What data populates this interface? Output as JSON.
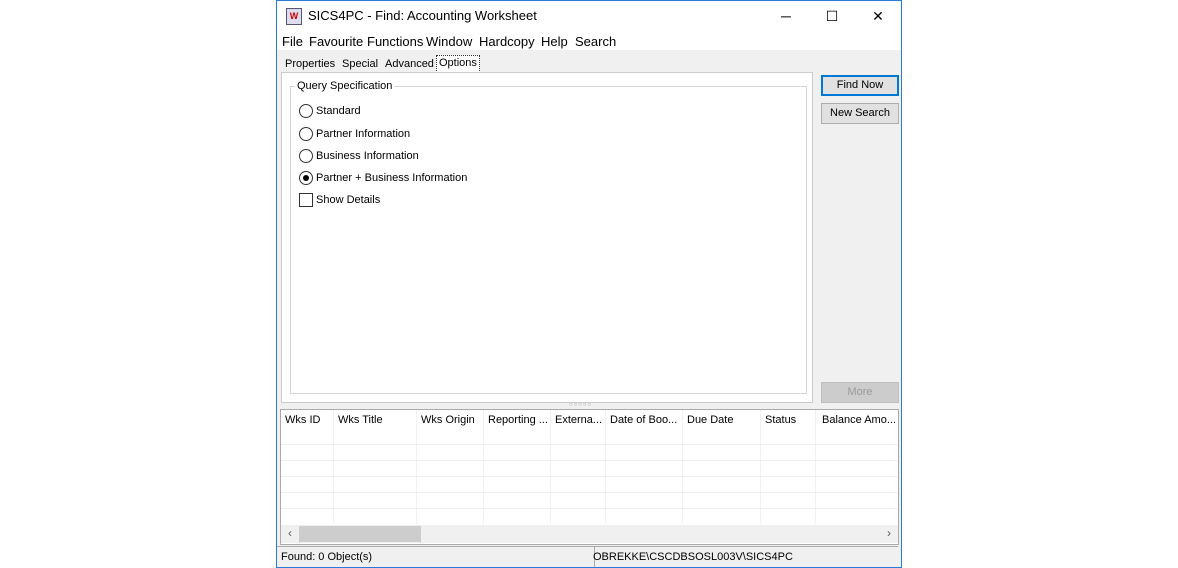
{
  "window": {
    "title": "SICS4PC - Find: Accounting Worksheet",
    "app_icon": "worksheet-icon",
    "controls": {
      "minimize": "─",
      "maximize": "☐",
      "close": "✕"
    }
  },
  "menu": [
    "File",
    "Favourite",
    "Functions",
    "Window",
    "Hardcopy",
    "Help",
    "Search"
  ],
  "tabs": [
    {
      "label": "Properties"
    },
    {
      "label": "Special"
    },
    {
      "label": "Advanced"
    },
    {
      "label": "Options",
      "active": true
    }
  ],
  "query": {
    "group_label": "Query Specification",
    "options": [
      {
        "label": "Standard",
        "selected": false
      },
      {
        "label": "Partner Information",
        "selected": false
      },
      {
        "label": "Business Information",
        "selected": false
      },
      {
        "label": "Partner + Business Information",
        "selected": true
      }
    ],
    "show_details": {
      "label": "Show Details",
      "checked": false
    }
  },
  "buttons": {
    "find_now": "Find Now",
    "new_search": "New Search",
    "more": "More"
  },
  "table": {
    "columns": [
      "Wks ID",
      "Wks Title",
      "Wks Origin",
      "Reporting ...",
      "Externa...",
      "Date of Boo...",
      "Due Date",
      "Status",
      "Balance Amo..."
    ],
    "rows": []
  },
  "status": {
    "found": "Found: 0 Object(s)",
    "path": "OBREKKE\\CSCDBSOSL003V\\SICS4PC"
  }
}
